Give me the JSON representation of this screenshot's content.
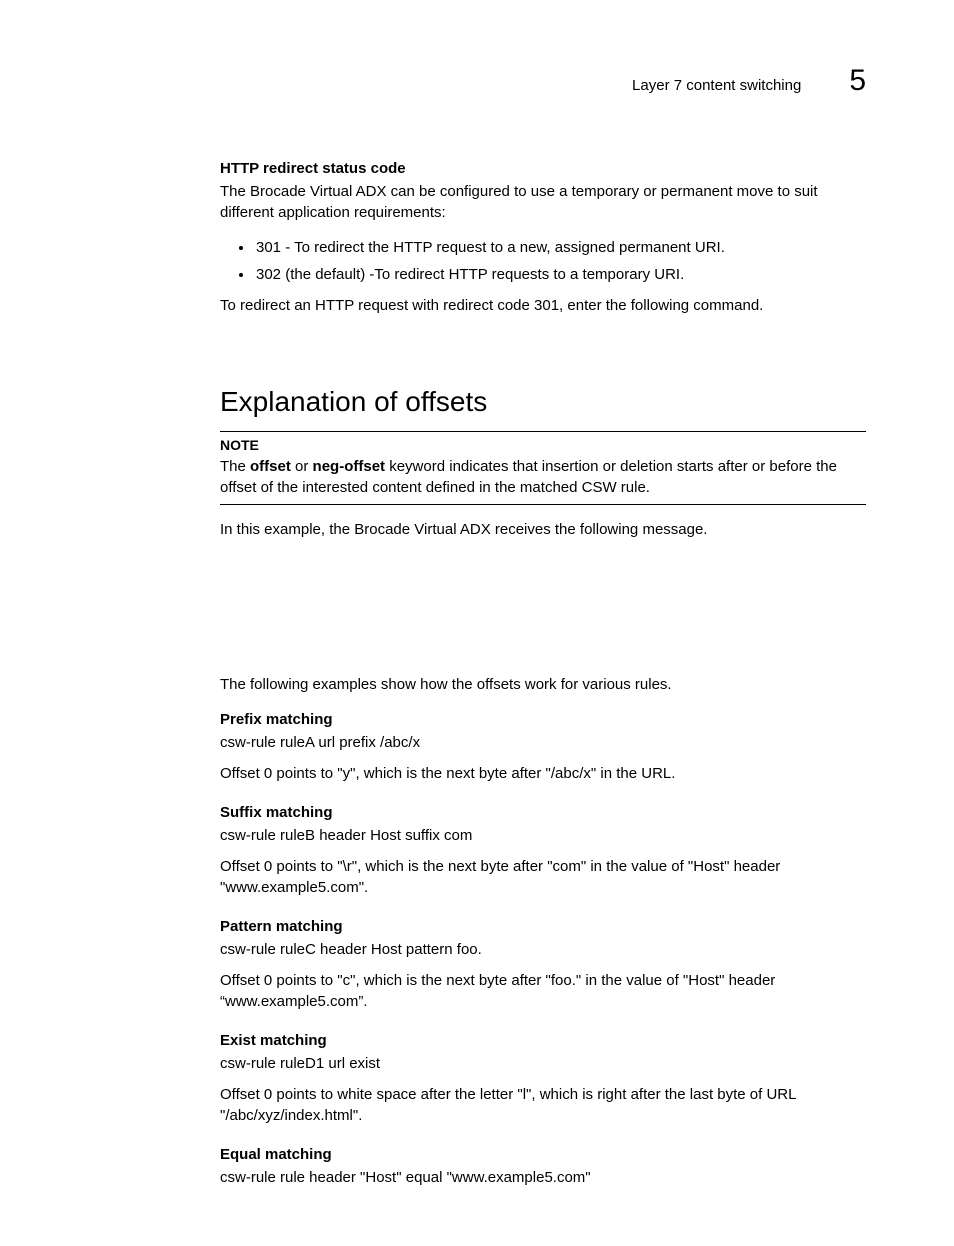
{
  "header": {
    "running_title": "Layer 7 content switching",
    "chapter_number": "5"
  },
  "intro_block": {
    "heading": "HTTP redirect status code",
    "para1": "The Brocade Virtual ADX can be configured to use a temporary or permanent move to suit different application requirements:",
    "bullets": [
      "301 - To redirect the HTTP request to a new, assigned permanent URI.",
      "302 (the default) -To redirect HTTP requests to a temporary URI."
    ],
    "para2": "To redirect an HTTP request with redirect code 301, enter the following command."
  },
  "section": {
    "title": "Explanation of offsets",
    "note_label": "NOTE",
    "note_body_prefix": "The ",
    "note_body_kw1": "offset",
    "note_body_mid": " or ",
    "note_body_kw2": "neg-offset",
    "note_body_suffix": " keyword indicates that insertion or deletion starts after or before the offset of the interested content defined in the matched CSW rule.",
    "after_note": "In this example, the Brocade Virtual ADX receives the following message.",
    "examples_intro": "The following examples show how the offsets work for various rules.",
    "rules": [
      {
        "heading": "Prefix matching",
        "line": "csw-rule ruleA url prefix /abc/x",
        "desc": "Offset 0 points to \"y\", which is the next byte after \"/abc/x\" in the URL."
      },
      {
        "heading": "Suffix matching",
        "line": "csw-rule ruleB header Host suffix com",
        "desc": "Offset 0 points to \"\\r\", which is the next byte after \"com\" in the value of \"Host\" header \"www.example5.com\"."
      },
      {
        "heading": "Pattern matching",
        "line": "csw-rule ruleC header Host pattern foo.",
        "desc": "Offset 0 points to \"c\", which is the next byte after \"foo.\" in the value of \"Host\" header “www.example5.com”."
      },
      {
        "heading": "Exist matching",
        "line": "csw-rule ruleD1 url exist",
        "desc": "Offset 0 points to white space after the letter \"l\", which is right after the last byte of URL \"/abc/xyz/index.html\"."
      },
      {
        "heading": "Equal matching",
        "line": "csw-rule rule header \"Host\" equal \"www.example5.com\"",
        "desc": ""
      }
    ]
  }
}
